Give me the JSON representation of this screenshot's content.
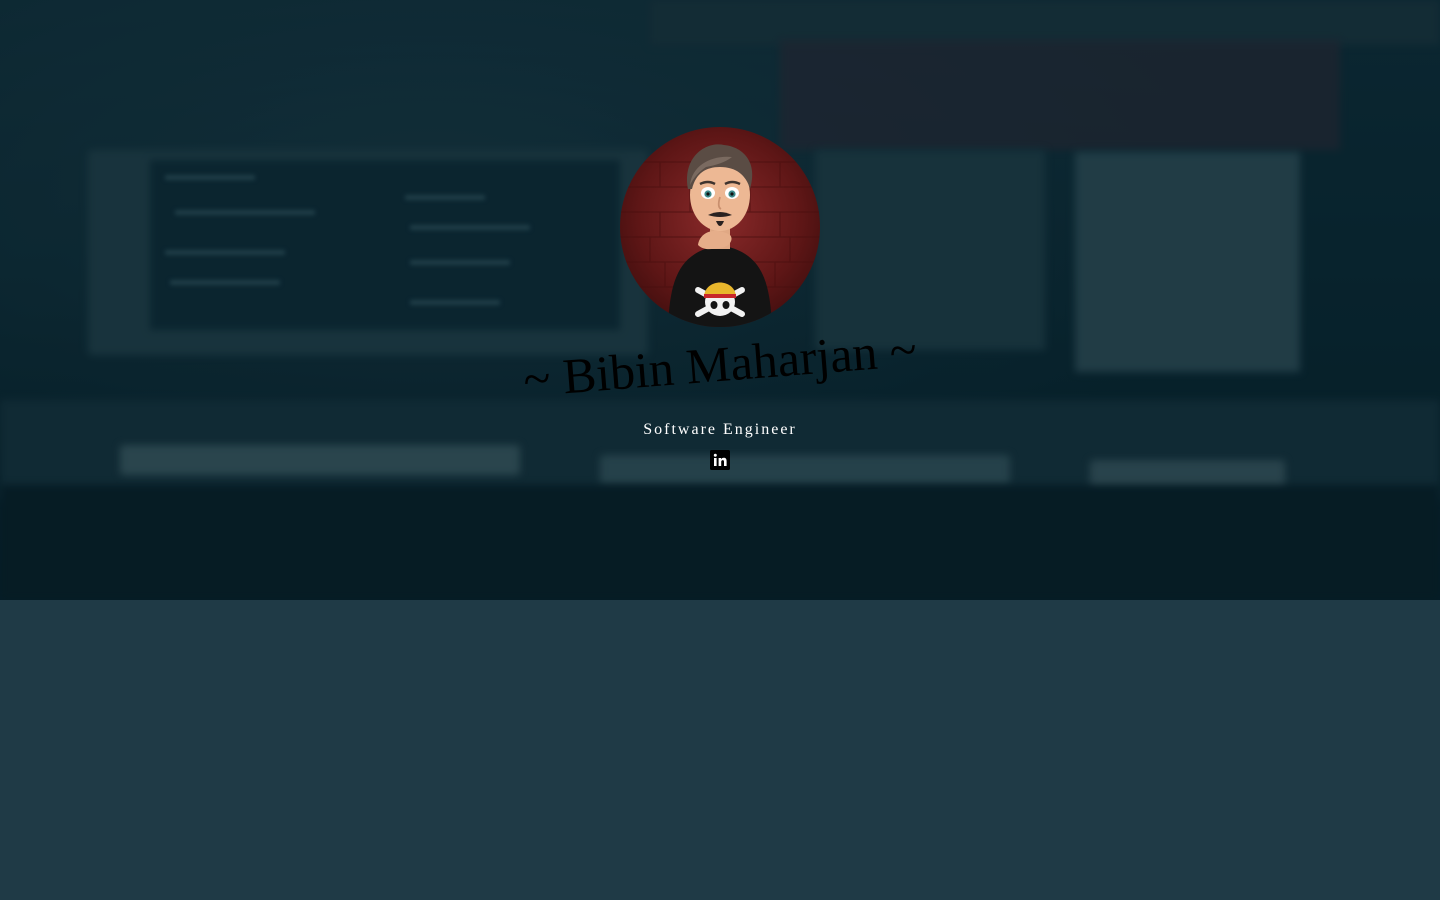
{
  "profile": {
    "name": "~ Bibin Maharjan ~",
    "role": "Software Engineer",
    "avatar_alt": "Bibin Maharjan avatar"
  },
  "social": {
    "linkedin_icon": "linkedin-icon"
  },
  "colors": {
    "page_background": "#1f3a46",
    "hero_overlay": "#0d2a33",
    "name_text": "#000000",
    "role_text": "#ffffff",
    "avatar_background": "#6e1c1c"
  }
}
